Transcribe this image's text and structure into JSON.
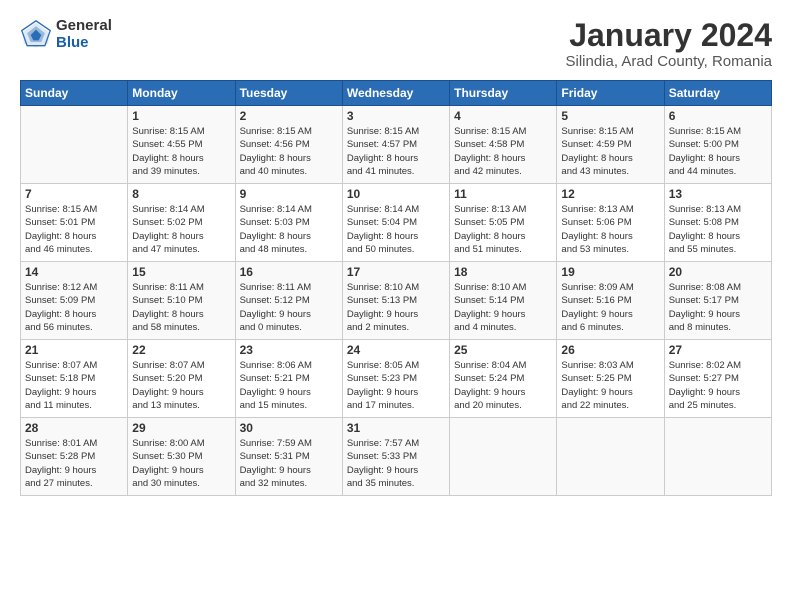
{
  "header": {
    "logo_general": "General",
    "logo_blue": "Blue",
    "title": "January 2024",
    "subtitle": "Silindia, Arad County, Romania"
  },
  "days_of_week": [
    "Sunday",
    "Monday",
    "Tuesday",
    "Wednesday",
    "Thursday",
    "Friday",
    "Saturday"
  ],
  "weeks": [
    [
      {
        "day": "",
        "info": ""
      },
      {
        "day": "1",
        "info": "Sunrise: 8:15 AM\nSunset: 4:55 PM\nDaylight: 8 hours\nand 39 minutes."
      },
      {
        "day": "2",
        "info": "Sunrise: 8:15 AM\nSunset: 4:56 PM\nDaylight: 8 hours\nand 40 minutes."
      },
      {
        "day": "3",
        "info": "Sunrise: 8:15 AM\nSunset: 4:57 PM\nDaylight: 8 hours\nand 41 minutes."
      },
      {
        "day": "4",
        "info": "Sunrise: 8:15 AM\nSunset: 4:58 PM\nDaylight: 8 hours\nand 42 minutes."
      },
      {
        "day": "5",
        "info": "Sunrise: 8:15 AM\nSunset: 4:59 PM\nDaylight: 8 hours\nand 43 minutes."
      },
      {
        "day": "6",
        "info": "Sunrise: 8:15 AM\nSunset: 5:00 PM\nDaylight: 8 hours\nand 44 minutes."
      }
    ],
    [
      {
        "day": "7",
        "info": "Sunrise: 8:15 AM\nSunset: 5:01 PM\nDaylight: 8 hours\nand 46 minutes."
      },
      {
        "day": "8",
        "info": "Sunrise: 8:14 AM\nSunset: 5:02 PM\nDaylight: 8 hours\nand 47 minutes."
      },
      {
        "day": "9",
        "info": "Sunrise: 8:14 AM\nSunset: 5:03 PM\nDaylight: 8 hours\nand 48 minutes."
      },
      {
        "day": "10",
        "info": "Sunrise: 8:14 AM\nSunset: 5:04 PM\nDaylight: 8 hours\nand 50 minutes."
      },
      {
        "day": "11",
        "info": "Sunrise: 8:13 AM\nSunset: 5:05 PM\nDaylight: 8 hours\nand 51 minutes."
      },
      {
        "day": "12",
        "info": "Sunrise: 8:13 AM\nSunset: 5:06 PM\nDaylight: 8 hours\nand 53 minutes."
      },
      {
        "day": "13",
        "info": "Sunrise: 8:13 AM\nSunset: 5:08 PM\nDaylight: 8 hours\nand 55 minutes."
      }
    ],
    [
      {
        "day": "14",
        "info": "Sunrise: 8:12 AM\nSunset: 5:09 PM\nDaylight: 8 hours\nand 56 minutes."
      },
      {
        "day": "15",
        "info": "Sunrise: 8:11 AM\nSunset: 5:10 PM\nDaylight: 8 hours\nand 58 minutes."
      },
      {
        "day": "16",
        "info": "Sunrise: 8:11 AM\nSunset: 5:12 PM\nDaylight: 9 hours\nand 0 minutes."
      },
      {
        "day": "17",
        "info": "Sunrise: 8:10 AM\nSunset: 5:13 PM\nDaylight: 9 hours\nand 2 minutes."
      },
      {
        "day": "18",
        "info": "Sunrise: 8:10 AM\nSunset: 5:14 PM\nDaylight: 9 hours\nand 4 minutes."
      },
      {
        "day": "19",
        "info": "Sunrise: 8:09 AM\nSunset: 5:16 PM\nDaylight: 9 hours\nand 6 minutes."
      },
      {
        "day": "20",
        "info": "Sunrise: 8:08 AM\nSunset: 5:17 PM\nDaylight: 9 hours\nand 8 minutes."
      }
    ],
    [
      {
        "day": "21",
        "info": "Sunrise: 8:07 AM\nSunset: 5:18 PM\nDaylight: 9 hours\nand 11 minutes."
      },
      {
        "day": "22",
        "info": "Sunrise: 8:07 AM\nSunset: 5:20 PM\nDaylight: 9 hours\nand 13 minutes."
      },
      {
        "day": "23",
        "info": "Sunrise: 8:06 AM\nSunset: 5:21 PM\nDaylight: 9 hours\nand 15 minutes."
      },
      {
        "day": "24",
        "info": "Sunrise: 8:05 AM\nSunset: 5:23 PM\nDaylight: 9 hours\nand 17 minutes."
      },
      {
        "day": "25",
        "info": "Sunrise: 8:04 AM\nSunset: 5:24 PM\nDaylight: 9 hours\nand 20 minutes."
      },
      {
        "day": "26",
        "info": "Sunrise: 8:03 AM\nSunset: 5:25 PM\nDaylight: 9 hours\nand 22 minutes."
      },
      {
        "day": "27",
        "info": "Sunrise: 8:02 AM\nSunset: 5:27 PM\nDaylight: 9 hours\nand 25 minutes."
      }
    ],
    [
      {
        "day": "28",
        "info": "Sunrise: 8:01 AM\nSunset: 5:28 PM\nDaylight: 9 hours\nand 27 minutes."
      },
      {
        "day": "29",
        "info": "Sunrise: 8:00 AM\nSunset: 5:30 PM\nDaylight: 9 hours\nand 30 minutes."
      },
      {
        "day": "30",
        "info": "Sunrise: 7:59 AM\nSunset: 5:31 PM\nDaylight: 9 hours\nand 32 minutes."
      },
      {
        "day": "31",
        "info": "Sunrise: 7:57 AM\nSunset: 5:33 PM\nDaylight: 9 hours\nand 35 minutes."
      },
      {
        "day": "",
        "info": ""
      },
      {
        "day": "",
        "info": ""
      },
      {
        "day": "",
        "info": ""
      }
    ]
  ]
}
